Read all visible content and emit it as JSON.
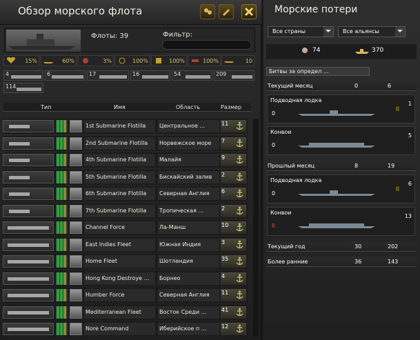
{
  "left": {
    "title": "Обзор морского флота",
    "fleets_label": "Флоты: 39",
    "filter_label": "Фильтр:",
    "filter_value": "",
    "stats": [
      {
        "icon": "heart-icon",
        "value": "15%"
      },
      {
        "icon": "ship-silhouette-icon",
        "value": "60%"
      },
      {
        "icon": "armor-icon",
        "value": "3%"
      },
      {
        "icon": "target-icon",
        "value": "100%"
      },
      {
        "icon": "fuel-icon",
        "value": "100%"
      },
      {
        "icon": "repair-icon",
        "value": "100%"
      },
      {
        "icon": "submarine-icon",
        "value": "10"
      }
    ],
    "ship_types": [
      "4",
      "6",
      "17",
      "16",
      "54",
      "209",
      "114"
    ],
    "columns": {
      "type": "Тип",
      "name": "Имя",
      "area": "Область",
      "size": "Размер"
    },
    "fleets": [
      {
        "name": "1st Submarine Flotilla",
        "area": "Центральное ...",
        "size": "11",
        "kind": "sub"
      },
      {
        "name": "2nd Submarine Flotilla",
        "area": "Норвежское море",
        "size": "7",
        "kind": "sub"
      },
      {
        "name": "4th Submarine Flotilla",
        "area": "Малайя",
        "size": "9",
        "kind": "sub"
      },
      {
        "name": "5th Submarine Flotilla",
        "area": "Бискайский залив",
        "size": "2",
        "kind": "sub"
      },
      {
        "name": "6th Submarine Flotilla",
        "area": "Северная Англия",
        "size": "6",
        "kind": "sub"
      },
      {
        "name": "7th Submarine Flotilla",
        "area": "Тропическая ...",
        "size": "2",
        "kind": "sub"
      },
      {
        "name": "Channel Force",
        "area": "Ла-Манш",
        "size": "10",
        "kind": "surface"
      },
      {
        "name": "East Indies Fleet",
        "area": "Южная Индия",
        "size": "3",
        "kind": "surface"
      },
      {
        "name": "Home Fleet",
        "area": "Шотландия",
        "size": "35",
        "kind": "surface"
      },
      {
        "name": "Hong Kong Destroye ...",
        "area": "Борнео",
        "size": "4",
        "kind": "surface"
      },
      {
        "name": "Humber Force",
        "area": "Северная Англия",
        "size": "11",
        "kind": "surface"
      },
      {
        "name": "Mediterranean Fleet",
        "area": "Восток Среди ...",
        "size": "41",
        "kind": "surface"
      },
      {
        "name": "Nore Command",
        "area": "Иберийское п ...",
        "size": "12",
        "kind": "surface"
      }
    ]
  },
  "right": {
    "title": "Морские потери",
    "country_select": "Все страны",
    "alliance_select": "Все альянсы",
    "losses_own": "74",
    "losses_enemy": "370",
    "tab_label": "Битвы за определ ...",
    "current_month": {
      "label": "Текущий месяц",
      "a": "0",
      "b": "6"
    },
    "card1": {
      "title": "Подводная лодка",
      "count": "0",
      "rank": "1"
    },
    "card2": {
      "title": "Конвои",
      "count": "0",
      "rank": "5"
    },
    "last_month": {
      "label": "Прошлый месяц",
      "a": "8",
      "b": "19"
    },
    "card3": {
      "title": "Подводная лодка",
      "count": "0",
      "rank": "6"
    },
    "card4": {
      "title": "Конвои",
      "count": "8",
      "rank": "13"
    },
    "current_year": {
      "label": "Текущий год",
      "a": "30",
      "b": "202"
    },
    "earlier": {
      "label": "Более ранние",
      "a": "36",
      "b": "143"
    }
  }
}
